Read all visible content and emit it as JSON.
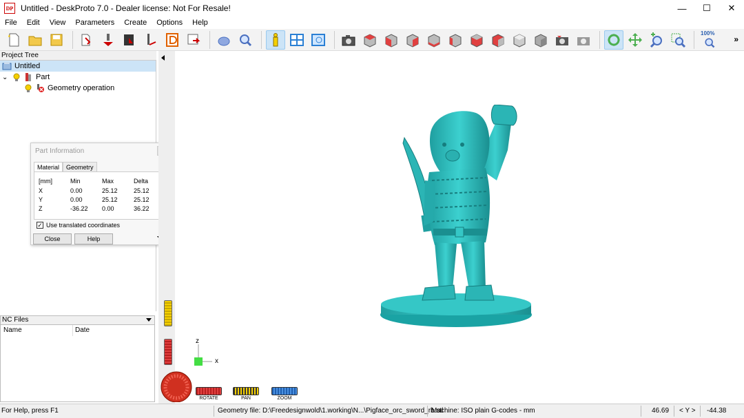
{
  "window": {
    "icon_text": "DP",
    "title": "Untitled - DeskProto 7.0 - Dealer license: Not For Resale!",
    "minimize": "—",
    "maximize": "☐",
    "close": "✕"
  },
  "menu": [
    "File",
    "Edit",
    "View",
    "Parameters",
    "Create",
    "Options",
    "Help"
  ],
  "toolbar": {
    "zoom_label": "100%",
    "more": "»"
  },
  "project_tree": {
    "header": "Project Tree",
    "root": "Untitled",
    "part": "Part",
    "operation": "Geometry operation",
    "expander": "⌄"
  },
  "part_info": {
    "title": "Part Information",
    "tabs": [
      "Material",
      "Geometry"
    ],
    "columns": [
      "[mm]",
      "Min",
      "Max",
      "Delta"
    ],
    "rows": [
      {
        "axis": "X",
        "min": "0.00",
        "max": "25.12",
        "delta": "25.12"
      },
      {
        "axis": "Y",
        "min": "0.00",
        "max": "25.12",
        "delta": "25.12"
      },
      {
        "axis": "Z",
        "min": "-36.22",
        "max": "0.00",
        "delta": "36.22"
      }
    ],
    "checkbox_label": "Use translated coordinates",
    "checkbox_mark": "✓",
    "close_label": "Close",
    "help_label": "Help"
  },
  "nc_files": {
    "header": "NC Files",
    "col_name": "Name",
    "col_date": "Date"
  },
  "viewport": {
    "axis_z": "z",
    "axis_x": "x",
    "rotate_label": "ROTATE",
    "pan_label": "PAN",
    "zoom_label": "ZOOM",
    "model_color": "#2bb5b5"
  },
  "status": {
    "help": "For Help, press F1",
    "geometry": "Geometry file: D:\\Freedesignwold\\1.working\\N...\\Pigface_orc_sword_rb.stl",
    "machine": "Machine: ISO plain G-codes - mm",
    "x_value": "46.69",
    "axis_label": "< Y >",
    "y_value": "-44.38"
  }
}
